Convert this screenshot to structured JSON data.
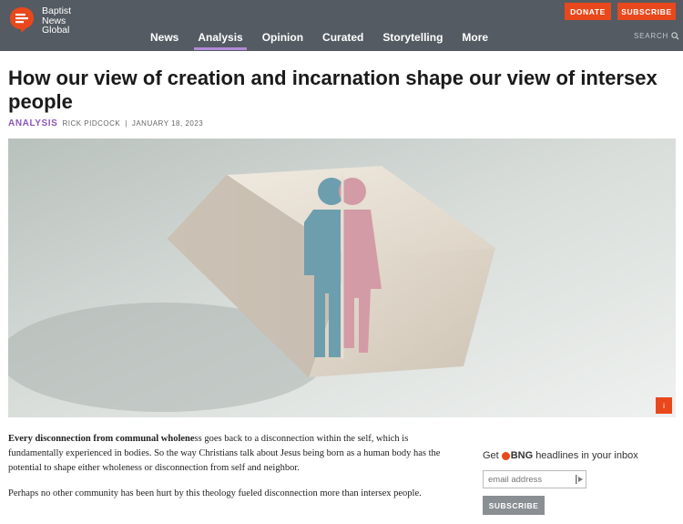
{
  "header": {
    "logo_lines": [
      "Baptist",
      "News",
      "Global"
    ],
    "nav": [
      {
        "label": "News",
        "active": false
      },
      {
        "label": "Analysis",
        "active": true
      },
      {
        "label": "Opinion",
        "active": false
      },
      {
        "label": "Curated",
        "active": false
      },
      {
        "label": "Storytelling",
        "active": false
      },
      {
        "label": "More",
        "active": false
      }
    ],
    "donate_label": "DONATE",
    "subscribe_label": "SUBSCRIBE",
    "search_label": "SEARCH",
    "search_icon": "search-icon",
    "accent_color": "#e8481c",
    "active_underline_color": "#b18ad8",
    "bar_color": "#545b62"
  },
  "article": {
    "title": "How our view of creation and incarnation shape our view of intersex people",
    "category": "ANALYSIS",
    "author": "RICK PIDCOCK",
    "separator": "|",
    "date": "JANUARY 18, 2023",
    "image_badge": "i",
    "paragraphs": [
      {
        "lead": "Every disconnection from communal wholene",
        "rest": "ss goes back to a disconnection within the self, which is fundamentally experienced in bodies. So the way Christians talk about Jesus being born as a human body has the potential to shape either wholeness or disconnection from self and neighbor."
      },
      {
        "lead": "",
        "rest": "Perhaps no other community has been hurt by this theology fueled disconnection more than intersex people."
      }
    ]
  },
  "signup": {
    "prefix": "Get",
    "brand": "BNG",
    "suffix": "headlines in your inbox",
    "email_placeholder": "email address",
    "button_label": "SUBSCRIBE"
  }
}
